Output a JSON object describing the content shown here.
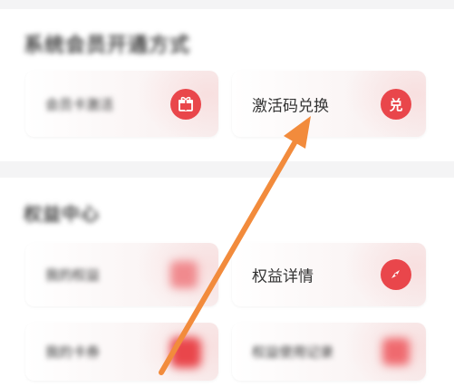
{
  "section1": {
    "title": "系统会员开通方式",
    "cards": [
      {
        "label": "会员卡激活",
        "icon": "gift-icon"
      },
      {
        "label": "激活码兑换",
        "icon": "redeem-icon",
        "icon_text": "兑"
      }
    ]
  },
  "section2": {
    "title": "权益中心",
    "cards": [
      {
        "label": "我的权益",
        "icon": "document-icon"
      },
      {
        "label": "权益详情",
        "icon": "compass-icon"
      },
      {
        "label": "我的卡券",
        "icon": "coupon-icon"
      },
      {
        "label": "权益使用记录",
        "icon": "record-icon"
      }
    ]
  },
  "colors": {
    "accent_red": "#e9464b",
    "arrow_orange": "#f28b3c"
  }
}
